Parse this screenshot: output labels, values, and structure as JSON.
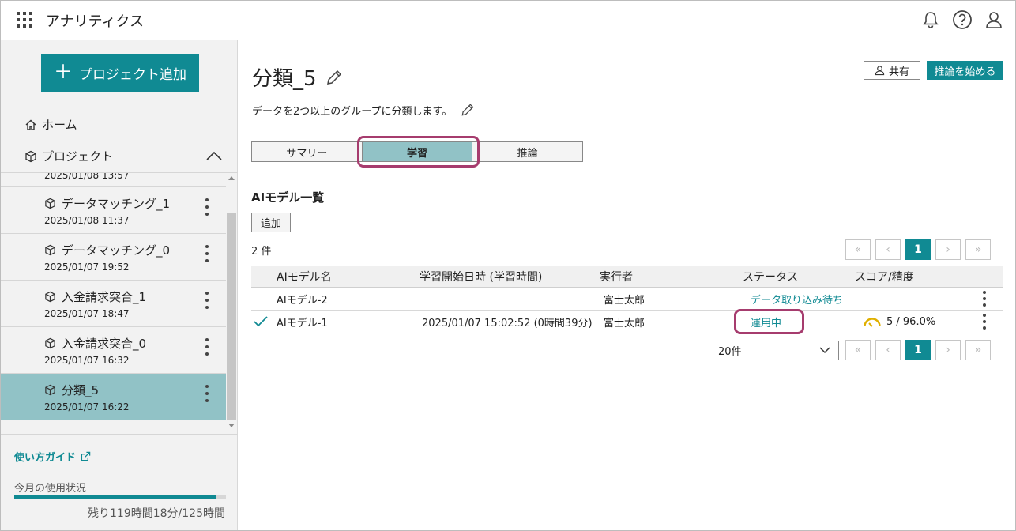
{
  "app": {
    "title": "アナリティクス"
  },
  "header": {
    "icons": [
      "grid-icon",
      "bell-icon",
      "help-icon",
      "user-icon"
    ]
  },
  "sidebar": {
    "add_project_label": "プロジェクト追加",
    "home_label": "ホーム",
    "project_label": "プロジェクト",
    "projects": [
      {
        "name": "",
        "date": "2025/01/08 13:57",
        "active": false
      },
      {
        "name": "データマッチング_1",
        "date": "2025/01/08 11:37",
        "active": false
      },
      {
        "name": "データマッチング_0",
        "date": "2025/01/07 19:52",
        "active": false
      },
      {
        "name": "入金請求突合_1",
        "date": "2025/01/07 18:47",
        "active": false
      },
      {
        "name": "入金請求突合_0",
        "date": "2025/01/07 16:32",
        "active": false
      },
      {
        "name": "分類_5",
        "date": "2025/01/07 16:22",
        "active": true
      }
    ],
    "guide_label": "使い方ガイド",
    "usage_label": "今月の使用状況",
    "usage_fraction": 0.953,
    "usage_remaining": "残り119時間18分/125時間"
  },
  "main": {
    "title": "分類_5",
    "description": "データを2つ以上のグループに分類します。",
    "share_label": "共有",
    "start_inference_label": "推論を始める",
    "tabs": [
      {
        "label": "サマリー",
        "active": false
      },
      {
        "label": "学習",
        "active": true
      },
      {
        "label": "推論",
        "active": false
      }
    ],
    "section_title": "AIモデル一覧",
    "add_label": "追加",
    "count": "2 件",
    "pager": {
      "first": "«",
      "prev": "‹",
      "current": "1",
      "next": "›",
      "last": "»"
    },
    "table": {
      "headers": {
        "name": "AIモデル名",
        "start": "学習開始日時 (学習時間)",
        "runner": "実行者",
        "status": "ステータス",
        "score": "スコア/精度"
      },
      "rows": [
        {
          "checked": false,
          "name": "AIモデル-2",
          "start": "",
          "runner": "富士太郎",
          "status": "データ取り込み待ち",
          "score": ""
        },
        {
          "checked": true,
          "name": "AIモデル-1",
          "start": "2025/01/07 15:02:52 (0時間39分)",
          "runner": "富士太郎",
          "status": "運用中",
          "score": "5 / 96.0%"
        }
      ]
    },
    "per_page": "20件"
  },
  "colors": {
    "accent": "#108a93",
    "active_bg": "#91c2c6",
    "highlight": "#a63c6e",
    "gauge": "#e0b000"
  }
}
